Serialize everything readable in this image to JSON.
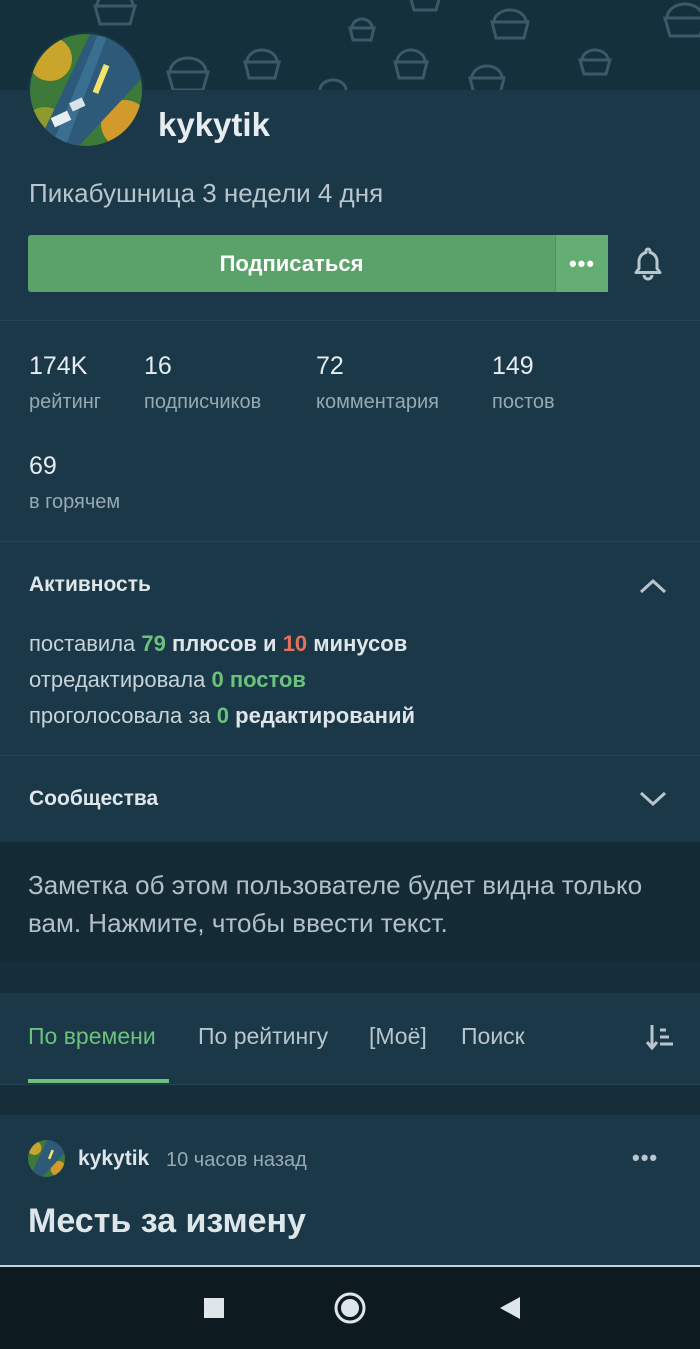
{
  "profile": {
    "username": "kykytik",
    "since": "Пикабушница 3 недели 4 дня",
    "subscribe_label": "Подписаться",
    "more_label": "•••"
  },
  "stats": [
    {
      "value": "174K",
      "caption": "рейтинг"
    },
    {
      "value": "16",
      "caption": "подписчиков"
    },
    {
      "value": "72",
      "caption": "комментария"
    },
    {
      "value": "149",
      "caption": "постов"
    },
    {
      "value": "69",
      "caption": "в горячем"
    }
  ],
  "activity": {
    "title": "Активность",
    "line1": {
      "prefix": "поставила ",
      "plus_count": "79",
      "middle": " плюсов и ",
      "minus_count": "10",
      "suffix": " минусов"
    },
    "line2": {
      "prefix": "отредактировала ",
      "count": "0",
      "suffix": " постов"
    },
    "line3": {
      "prefix": "проголосовала за ",
      "count": "0",
      "suffix": " редактирований"
    }
  },
  "communities": {
    "title": "Сообщества"
  },
  "note": {
    "text": "Заметка об этом пользователе будет видна только вам. Нажмите, чтобы ввести текст."
  },
  "tabs": [
    {
      "label": "По времени",
      "active": true
    },
    {
      "label": "По рейтингу",
      "active": false
    },
    {
      "label": "[Моё]",
      "active": false
    },
    {
      "label": "Поиск",
      "active": false
    }
  ],
  "post": {
    "author": "kykytik",
    "time": "10 часов назад",
    "more_label": "•••",
    "title": "Месть за измену"
  },
  "colors": {
    "background": "#162e3a",
    "card": "#1a3847",
    "accent_green": "#6cc27d",
    "accent_red": "#e5715d",
    "button_green": "#5aa26a"
  },
  "icons": [
    "bell-icon",
    "chevron-up-icon",
    "chevron-down-icon",
    "sort-icon",
    "nav-square-icon",
    "nav-circle-icon",
    "nav-back-icon"
  ]
}
